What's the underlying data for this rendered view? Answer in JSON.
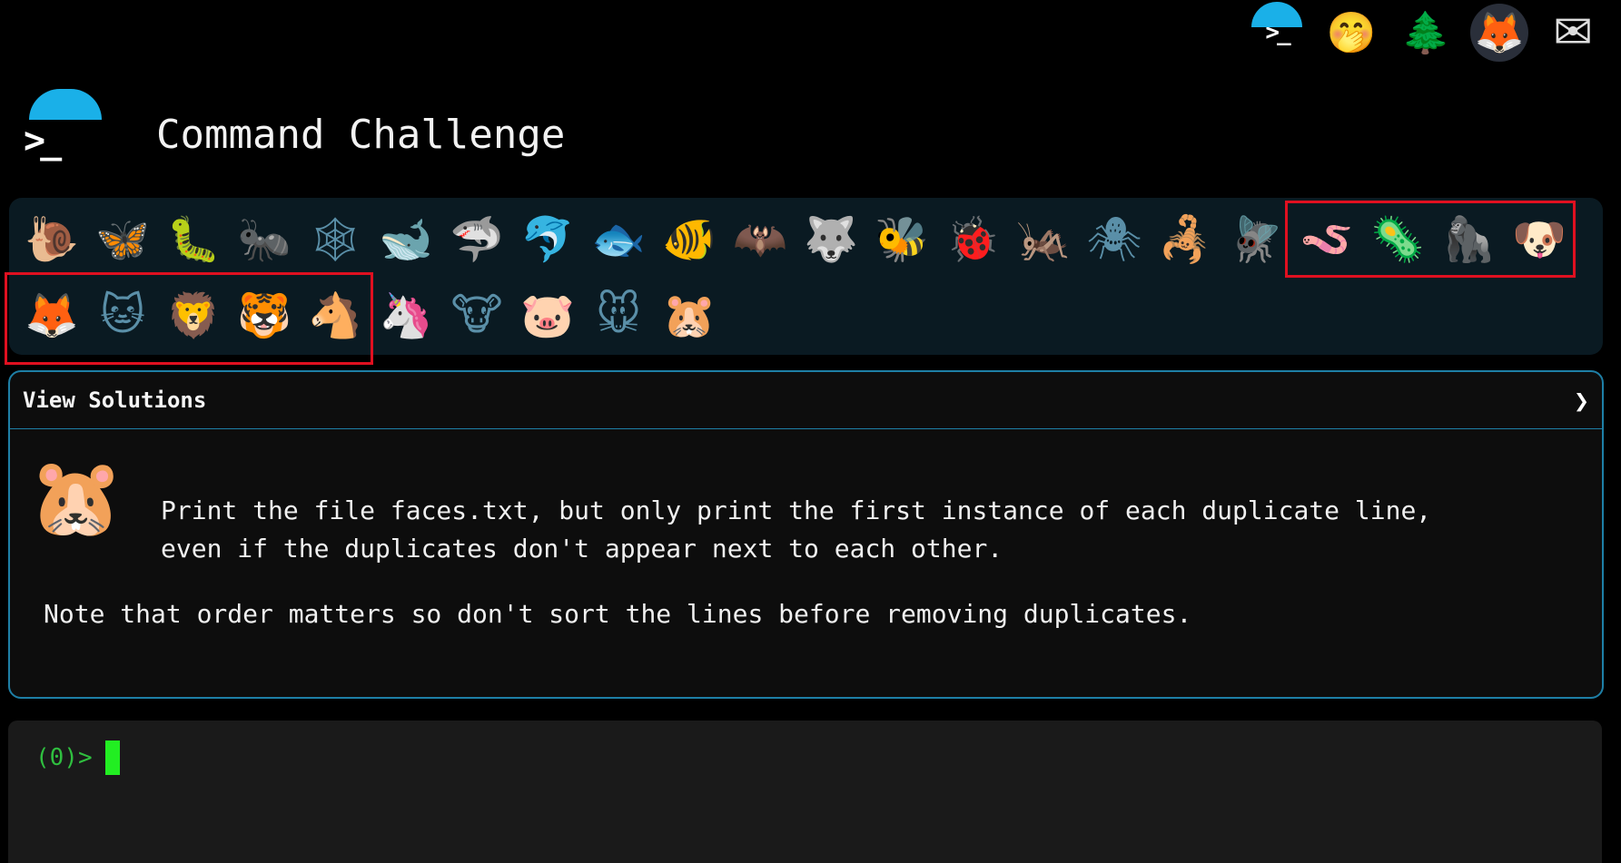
{
  "top_icons": [
    {
      "name": "terminal-umbrella-icon",
      "glyph": ">_"
    },
    {
      "name": "hand-over-mouth-face-icon",
      "glyph": "🤭"
    },
    {
      "name": "evergreen-tree-icon",
      "glyph": "🌲"
    },
    {
      "name": "gitlab-fox-icon",
      "glyph": "🦊"
    },
    {
      "name": "envelope-icon",
      "glyph": "✉"
    }
  ],
  "header": {
    "prompt_glyph": ">_",
    "title": "Command Challenge"
  },
  "challenges_row1": [
    {
      "name": "snail-icon",
      "glyph": "🐌"
    },
    {
      "name": "butterfly-icon",
      "glyph": "🦋"
    },
    {
      "name": "caterpillar-icon",
      "glyph": "🐛"
    },
    {
      "name": "ant-icon",
      "glyph": "🐜"
    },
    {
      "name": "spider-web-icon",
      "glyph": "🕸"
    },
    {
      "name": "whale-icon",
      "glyph": "🐋"
    },
    {
      "name": "shark-icon",
      "glyph": "🦈"
    },
    {
      "name": "dolphin-icon",
      "glyph": "🐬"
    },
    {
      "name": "fish-icon",
      "glyph": "🐟"
    },
    {
      "name": "tropical-fish-icon",
      "glyph": "🐠"
    },
    {
      "name": "bat-icon",
      "glyph": "🦇"
    },
    {
      "name": "wolf-icon",
      "glyph": "🐺"
    },
    {
      "name": "bee-icon",
      "glyph": "🐝"
    },
    {
      "name": "ladybug-icon",
      "glyph": "🐞"
    },
    {
      "name": "cricket-icon",
      "glyph": "🦗"
    },
    {
      "name": "spider-icon",
      "glyph": "🕷"
    },
    {
      "name": "scorpion-icon",
      "glyph": "🦂"
    },
    {
      "name": "fly-icon",
      "glyph": "🪰"
    },
    {
      "name": "worm-icon",
      "glyph": "🪱"
    },
    {
      "name": "microbe-icon",
      "glyph": "🦠"
    },
    {
      "name": "gorilla-icon",
      "glyph": "🦍"
    },
    {
      "name": "dog-icon",
      "glyph": "🐶"
    }
  ],
  "challenges_row2": [
    {
      "name": "fox-icon",
      "glyph": "🦊"
    },
    {
      "name": "cat-icon",
      "glyph": "🐱"
    },
    {
      "name": "lion-icon",
      "glyph": "🦁"
    },
    {
      "name": "tiger-icon",
      "glyph": "🐯"
    },
    {
      "name": "horse-icon",
      "glyph": "🐴"
    },
    {
      "name": "unicorn-icon",
      "glyph": "🦄"
    },
    {
      "name": "cow-icon",
      "glyph": "🐮"
    },
    {
      "name": "pig-icon",
      "glyph": "🐷"
    },
    {
      "name": "mouse-icon",
      "glyph": "🐭"
    },
    {
      "name": "hamster-icon",
      "glyph": "🐹"
    }
  ],
  "card": {
    "toggle_label": "View Solutions",
    "chevron": "❯",
    "current_icon": "🐹",
    "description_line1": "Print the file faces.txt, but only print the first instance of each duplicate line,",
    "description_line2": "even if the duplicates don't appear next to each other.",
    "note": "Note that order matters so don't sort the lines before removing duplicates."
  },
  "terminal": {
    "prompt": "(0)>"
  },
  "colors": {
    "accent": "#1e7fa6",
    "highlight": "#e01020",
    "prompt": "#2fbf3f",
    "cursor": "#22ee22"
  }
}
